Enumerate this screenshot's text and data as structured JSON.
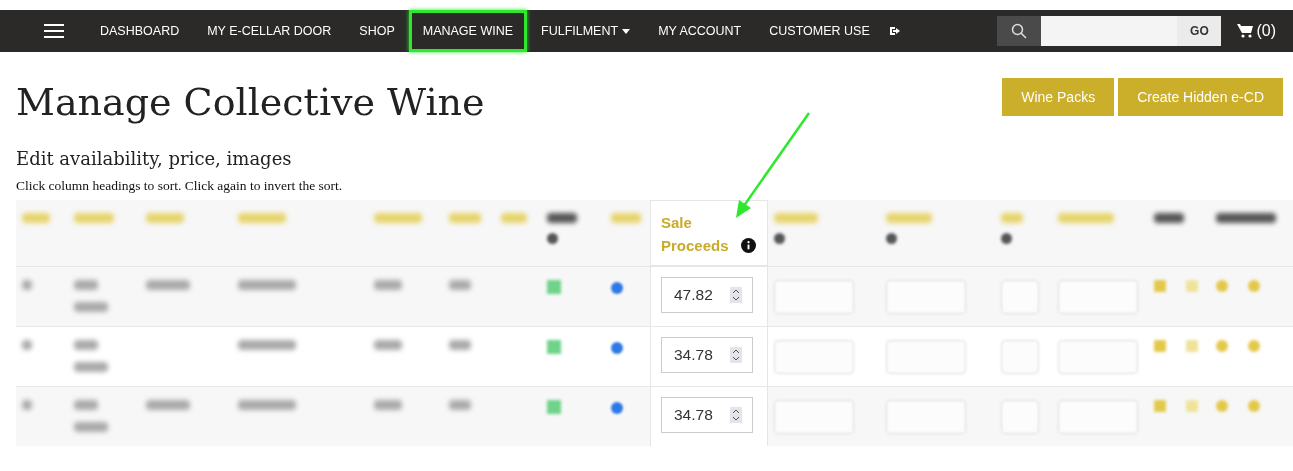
{
  "nav": {
    "items": [
      {
        "label": "DASHBOARD",
        "highlighted": false,
        "dropdown": false
      },
      {
        "label": "MY E-CELLAR DOOR",
        "highlighted": false,
        "dropdown": false
      },
      {
        "label": "SHOP",
        "highlighted": false,
        "dropdown": false
      },
      {
        "label": "MANAGE WINE",
        "highlighted": true,
        "dropdown": false
      },
      {
        "label": "FULFILMENT",
        "highlighted": false,
        "dropdown": true
      },
      {
        "label": "MY ACCOUNT",
        "highlighted": false,
        "dropdown": false
      },
      {
        "label": "CUSTOMER USE",
        "highlighted": false,
        "dropdown": false
      }
    ],
    "search_button": "GO",
    "cart": "(0)"
  },
  "page": {
    "title": "Manage Collective Wine",
    "buttons": [
      "Wine Packs",
      "Create Hidden e-CD"
    ],
    "subtitle": "Edit availability, price, images",
    "hint": "Click column headings to sort. Click again to invert the sort."
  },
  "table": {
    "columns": [
      {
        "kind": "text"
      },
      {
        "kind": "text2"
      },
      {
        "kind": "label"
      },
      {
        "kind": "text"
      },
      {
        "kind": "text"
      },
      {
        "kind": "text"
      },
      {
        "kind": "none"
      },
      {
        "kind": "cola"
      },
      {
        "kind": "live"
      },
      {
        "kind": "price",
        "label": "Sale Proceeds"
      },
      {
        "kind": "input"
      },
      {
        "kind": "input"
      },
      {
        "kind": "small-input"
      },
      {
        "kind": "stock"
      },
      {
        "kind": "edit"
      },
      {
        "kind": "manage"
      }
    ],
    "rows": [
      {
        "sale_proceeds": "47.82",
        "has_label": true
      },
      {
        "sale_proceeds": "34.78",
        "has_label": false
      },
      {
        "sale_proceeds": "34.78",
        "has_label": true
      }
    ]
  }
}
